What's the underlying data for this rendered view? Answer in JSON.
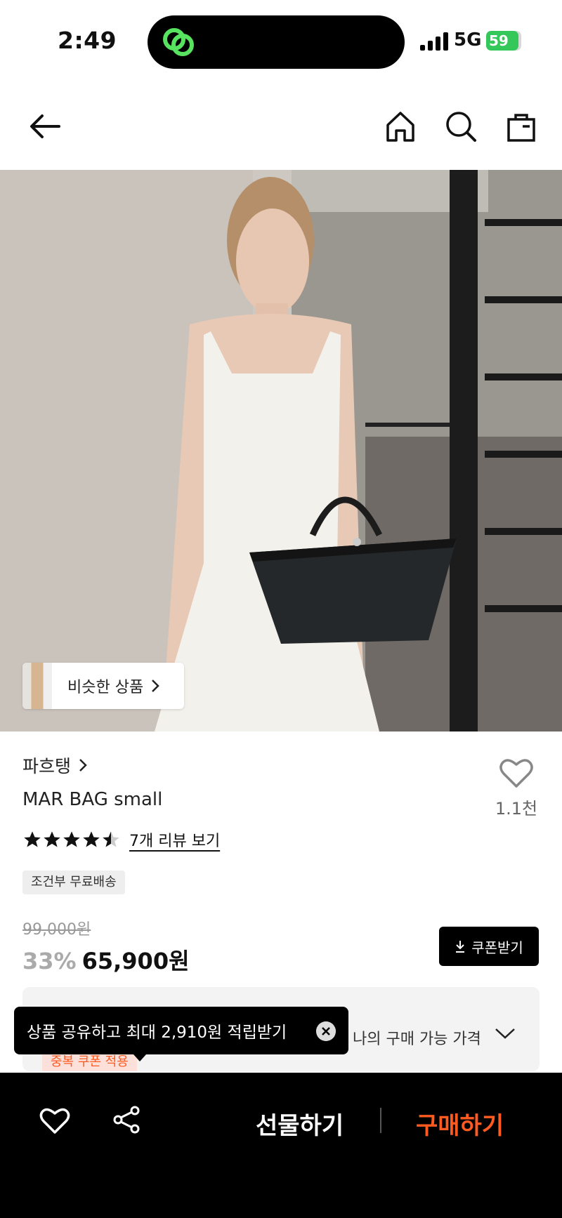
{
  "status_bar": {
    "time": "2:49",
    "network": "5G",
    "battery": "59"
  },
  "nav": {
    "icons": [
      "back-arrow-icon",
      "home-icon",
      "search-icon",
      "shopping-bag-icon"
    ]
  },
  "hero": {
    "similar_label": "비슷한 상품"
  },
  "product": {
    "brand": "파흐탱",
    "name": "MAR BAG small",
    "likes": "1.1천",
    "rating": 4.5,
    "reviews_link": "7개 리뷰 보기",
    "shipping_chip": "조건부 무료배송",
    "original_price": "99,000원",
    "discount": "33%",
    "price": "65,900원",
    "coupon_button": "쿠폰받기"
  },
  "panel": {
    "my_price": "나의 구매 가능 가격",
    "applied_chip": "중복 쿠폰 적용"
  },
  "tooltip": {
    "text": "상품 공유하고 최대 2,910원 적립받기"
  },
  "bottom_bar": {
    "gift_label": "선물하기",
    "buy_label": "구매하기"
  },
  "colors": {
    "accent": "#ff5a1f",
    "battery": "#34c759"
  }
}
